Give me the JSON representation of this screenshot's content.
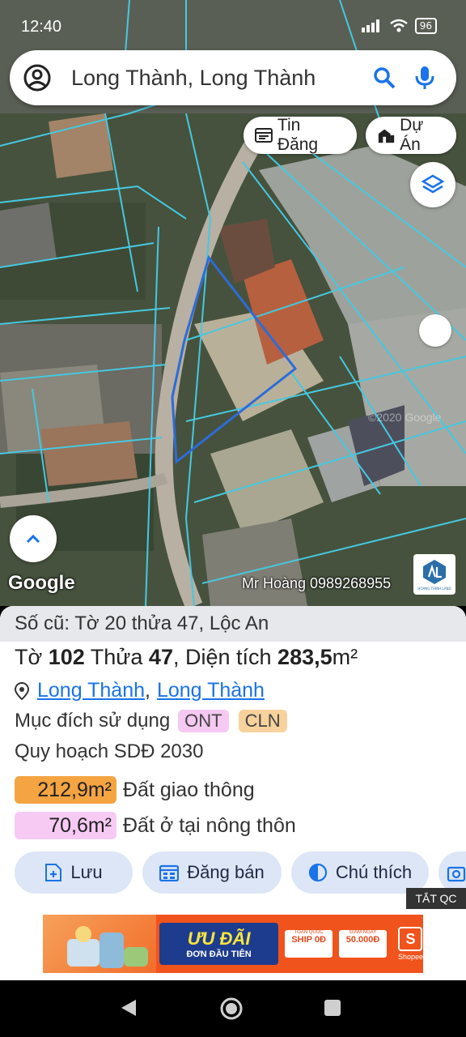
{
  "status_bar": {
    "time": "12:40",
    "battery": "96"
  },
  "search": {
    "query": "Long Thành, Long Thành"
  },
  "chips": {
    "listing": "Tin Đăng",
    "project": "Dự Án"
  },
  "map": {
    "attribution": "Google",
    "watermark": "Mr Hoàng 0989268955",
    "brand_logo_text": "HOANG THINH LAND"
  },
  "parcel": {
    "old_info": "Số cũ: Tờ 20 thửa 47, Lộc An",
    "sheet_label": "Tờ",
    "sheet": "102",
    "plot_label": "Thửa",
    "plot": "47",
    "area_label": ", Diện tích",
    "area": "283,5",
    "area_unit": "m²",
    "location": {
      "ward": "Long Thành",
      "district": "Long Thành"
    },
    "purpose_label": "Mục đích sử dụng",
    "purpose_codes": [
      "ONT",
      "CLN"
    ],
    "plan_label": "Quy hoạch SDĐ 2030",
    "plan_areas": [
      {
        "value": "212,9m²",
        "label": "Đất giao thông",
        "color": "#f5a442"
      },
      {
        "value": "70,6m²",
        "label": "Đất ở tại nông thôn",
        "color": "#f7caf4"
      }
    ]
  },
  "actions": {
    "save": "Lưu",
    "post_sale": "Đăng bán",
    "legend": "Chú thích"
  },
  "ad": {
    "close": "TẮT QC",
    "headline": "ƯU ĐÃI",
    "subline": "ĐƠN ĐẦU TIÊN",
    "coupon1_title": "TOÀN QUỐC",
    "coupon1_value": "SHIP 0Đ",
    "coupon2_title": "GIẢM NGAY",
    "coupon2_value": "50.000Đ",
    "brand": "Shopee"
  },
  "colors": {
    "accent": "#1a73e8",
    "chip_bg": "#dde6f6",
    "parcel_border": "#2f6bd8",
    "cadastral_lines": "#46c8e0"
  }
}
